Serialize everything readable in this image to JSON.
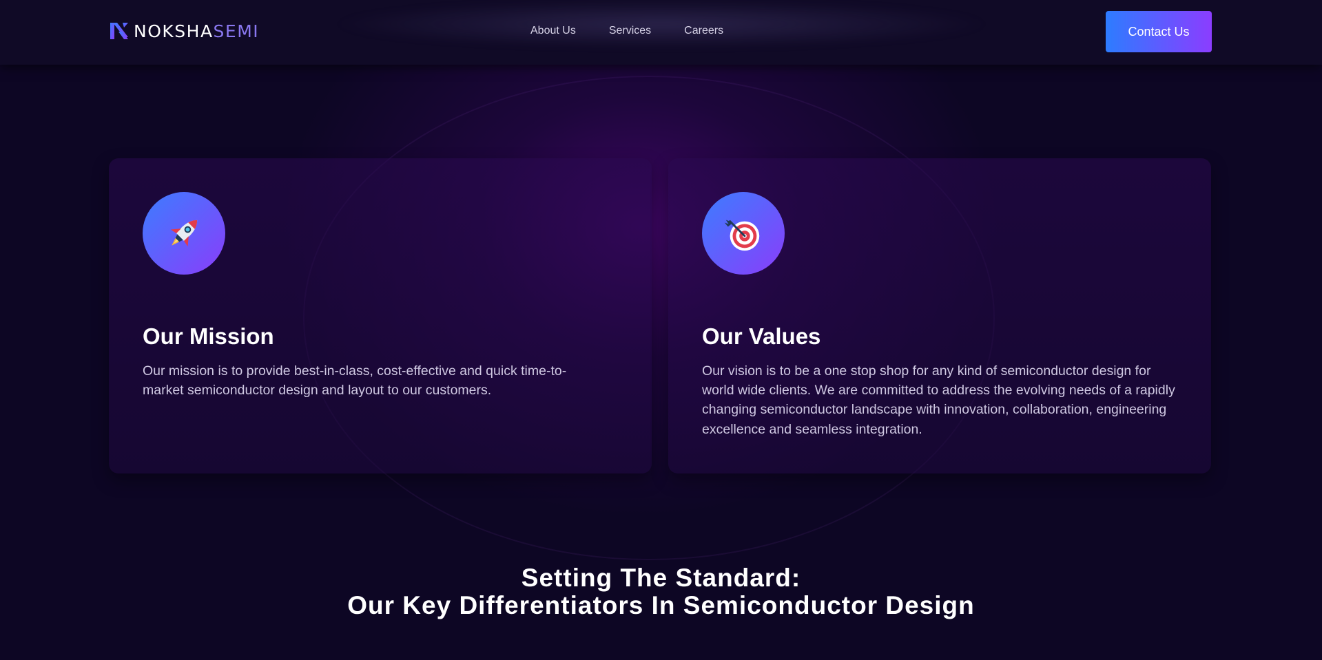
{
  "header": {
    "logo": {
      "part1": "NOKSHA",
      "part2": "SEMI"
    },
    "nav": [
      {
        "label": "About Us"
      },
      {
        "label": "Services"
      },
      {
        "label": "Careers"
      }
    ],
    "contact_label": "Contact Us"
  },
  "cards": [
    {
      "icon": "rocket-icon",
      "title": "Our Mission",
      "text": "Our mission is to provide best-in-class, cost-effective and quick time-to-market semiconductor design and layout to our customers."
    },
    {
      "icon": "target-icon",
      "title": "Our Values",
      "text": "Our vision is to be a one stop shop for any kind of semiconductor design for world wide clients. We are committed to address the evolving needs of a rapidly changing semiconductor landscape with innovation, collaboration, engineering excellence and seamless integration."
    }
  ],
  "section": {
    "title_line1": "Setting The Standard:",
    "title_line2": "Our Key Differentiators In Semiconductor Design"
  },
  "colors": {
    "background": "#0d0624",
    "accent_start": "#2d7cff",
    "accent_end": "#8b3dff",
    "logo_accent": "#8a78f0"
  }
}
